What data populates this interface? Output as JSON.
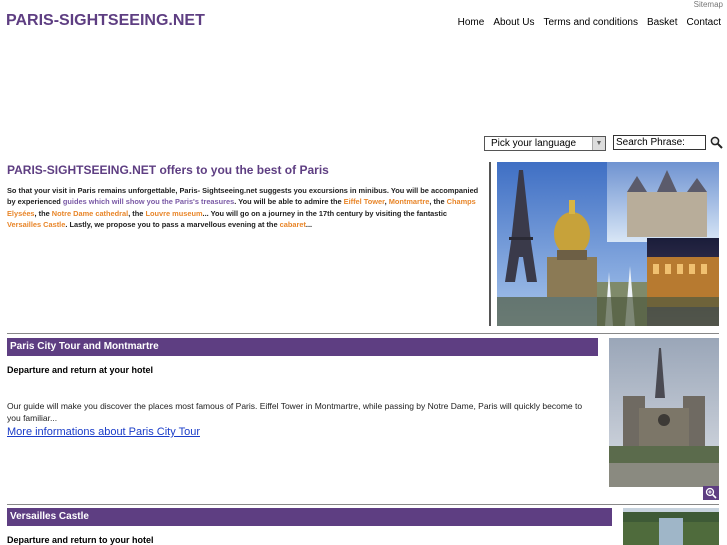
{
  "header": {
    "sitemap": "Sitemap",
    "logo": "PARIS-SIGHTSEEING.NET",
    "nav": [
      "Home",
      "About Us",
      "Terms and conditions",
      "Basket",
      "Contact"
    ]
  },
  "tools": {
    "language_select": "Pick your language",
    "search_value": "Search Phrase:"
  },
  "intro": {
    "title": "PARIS-SIGHTSEEING.NET offers to you the best of Paris",
    "t1": "So that your visit in Paris remains unforgettable, Paris- Sightseeing.net suggests you excursions in minibus. You will be accompanied by experienced ",
    "l_guides": "guides which will show you the Paris's treasures",
    "t2": ". You will be able to admire the ",
    "l_eiffel": "Eiffel Tower",
    "t3": ", ",
    "l_montmartre": "Montmartre",
    "t4": ", the ",
    "l_champs": "Champs Elysées",
    "t5": ", the ",
    "l_notre": "Notre Dame cathedral",
    "t6": ", the ",
    "l_louvre": "Louvre museum",
    "t7": "... You will go on a journey in the 17th century by visiting the fantastic ",
    "l_versailles": "Versailles Castle",
    "t8": ". Lastly, we propose you to pass a marvellous evening at the ",
    "l_cabaret": "cabaret",
    "t9": "..."
  },
  "tours": [
    {
      "title": "Paris City Tour and Montmartre",
      "subtitle": "Departure and return at your hotel",
      "description": "Our guide will make you discover the places most famous of Paris. Eiffel Tower in Montmartre, while passing by Notre Dame, Paris will quickly become to you familiar...",
      "link": "More informations about Paris City Tour"
    },
    {
      "title": "Versailles Castle",
      "subtitle": "Departure and return to your hotel"
    }
  ],
  "icons": {
    "search": "magnifier-icon",
    "zoom": "zoom-in-icon",
    "dropdown": "chevron-down-icon"
  },
  "colors": {
    "brand_purple": "#5e3e82",
    "link_orange": "#e8862a",
    "link_blue": "#1a3cc8"
  }
}
